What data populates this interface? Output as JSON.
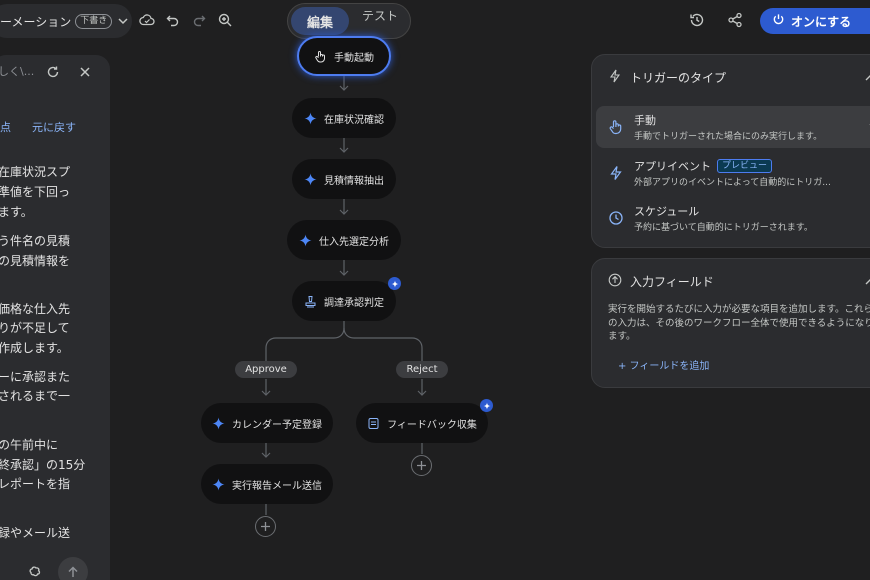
{
  "header": {
    "title": "ーメーション",
    "draft_badge": "下書き",
    "mode_edit": "編集",
    "mode_test": "テスト",
    "on_button": "オンにする"
  },
  "chat": {
    "search_placeholder": "しく\\...",
    "link_left": "点",
    "link_restore": "元に戻す",
    "lines": [
      "在庫状況スプ",
      "準値を下回っ",
      "ます。",
      "う件名の見積",
      "の見積情報を",
      "価格な仕入先",
      "りが不足して",
      "作成します。",
      "ーに承認また",
      "されるまで一",
      "の午前中に",
      "終承認」の15分",
      "レポートを指",
      "録やメール送"
    ]
  },
  "workflow": {
    "nodes": [
      {
        "id": "start",
        "label": "手動起動",
        "icon": "hand-icon"
      },
      {
        "id": "n1",
        "label": "在庫状況確認",
        "icon": "sparkle-icon"
      },
      {
        "id": "n2",
        "label": "見積情報抽出",
        "icon": "sparkle-icon"
      },
      {
        "id": "n3",
        "label": "仕入先選定分析",
        "icon": "sparkle-icon"
      },
      {
        "id": "n4",
        "label": "調達承認判定",
        "icon": "approval-icon"
      },
      {
        "id": "n5",
        "label": "カレンダー予定登録",
        "icon": "sparkle-icon"
      },
      {
        "id": "n6",
        "label": "実行報告メール送信",
        "icon": "sparkle-icon"
      },
      {
        "id": "n7",
        "label": "フィードバック収集",
        "icon": "form-icon"
      }
    ],
    "branches": {
      "approve": "Approve",
      "reject": "Reject"
    }
  },
  "trigger_panel": {
    "title": "トリガーのタイプ",
    "items": [
      {
        "title": "手動",
        "desc": "手動でトリガーされた場合にのみ実行します。",
        "icon": "hand-icon",
        "selected": true
      },
      {
        "title": "アプリイベント",
        "badge": "プレビュー",
        "desc": "外部アプリのイベントによって自動的にトリガ...",
        "icon": "bolt-icon",
        "selected": false
      },
      {
        "title": "スケジュール",
        "desc": "予約に基づいて自動的にトリガーされます。",
        "icon": "clock-icon",
        "selected": false
      }
    ]
  },
  "input_panel": {
    "title": "入力フィールド",
    "desc": "実行を開始するたびに入力が必要な項目を追加します。これらの入力は、その後のワークフロー全体で使用できるようになります。",
    "add_field": "+ フィールドを追加"
  },
  "colors": {
    "accent": "#2d5bd0",
    "link": "#8ab4f8",
    "bg": "#1f1f20",
    "panel": "#2b2c2f",
    "node": "#111112"
  }
}
